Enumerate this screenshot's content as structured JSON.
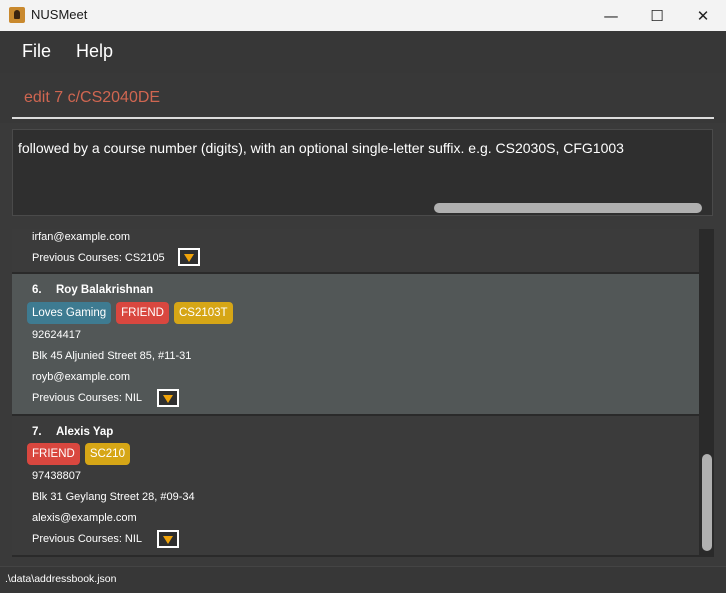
{
  "window": {
    "title": "NUSMeet",
    "minimize_glyph": "—",
    "maximize_glyph": "☐",
    "close_glyph": "✕"
  },
  "menu": {
    "items": [
      "File",
      "Help"
    ]
  },
  "command": {
    "value": "edit 7 c/CS2040DE"
  },
  "result": {
    "text": "followed by a course number (digits), with an optional single-letter suffix. e.g. CS2030S, CFG1003"
  },
  "colors": {
    "tag_blue": "#3e7b91",
    "tag_red": "#d9473f",
    "tag_yellow": "#d6a616",
    "command_error": "#d06651",
    "dropdown_arrow": "#f0a30a"
  },
  "persons": [
    {
      "index": "",
      "name": "",
      "tags": [],
      "phone": "",
      "address": "",
      "email": "irfan@example.com",
      "previous_courses": "Previous Courses: CS2105"
    },
    {
      "index": "6.",
      "name": "Roy Balakrishnan",
      "tags": [
        {
          "label": "Loves Gaming",
          "color": "tag_blue"
        },
        {
          "label": "FRIEND",
          "color": "tag_red"
        },
        {
          "label": "CS2103T",
          "color": "tag_yellow"
        }
      ],
      "phone": "92624417",
      "address": "Blk 45 Aljunied Street 85, #11-31",
      "email": "royb@example.com",
      "previous_courses": "Previous Courses: NIL"
    },
    {
      "index": "7.",
      "name": "Alexis Yap",
      "tags": [
        {
          "label": "FRIEND",
          "color": "tag_red"
        },
        {
          "label": "SC210",
          "color": "tag_yellow"
        }
      ],
      "phone": "97438807",
      "address": "Blk 31 Geylang Street 28, #09-34",
      "email": "alexis@example.com",
      "previous_courses": "Previous Courses: NIL"
    }
  ],
  "status": {
    "path": ".\\data\\addressbook.json"
  }
}
